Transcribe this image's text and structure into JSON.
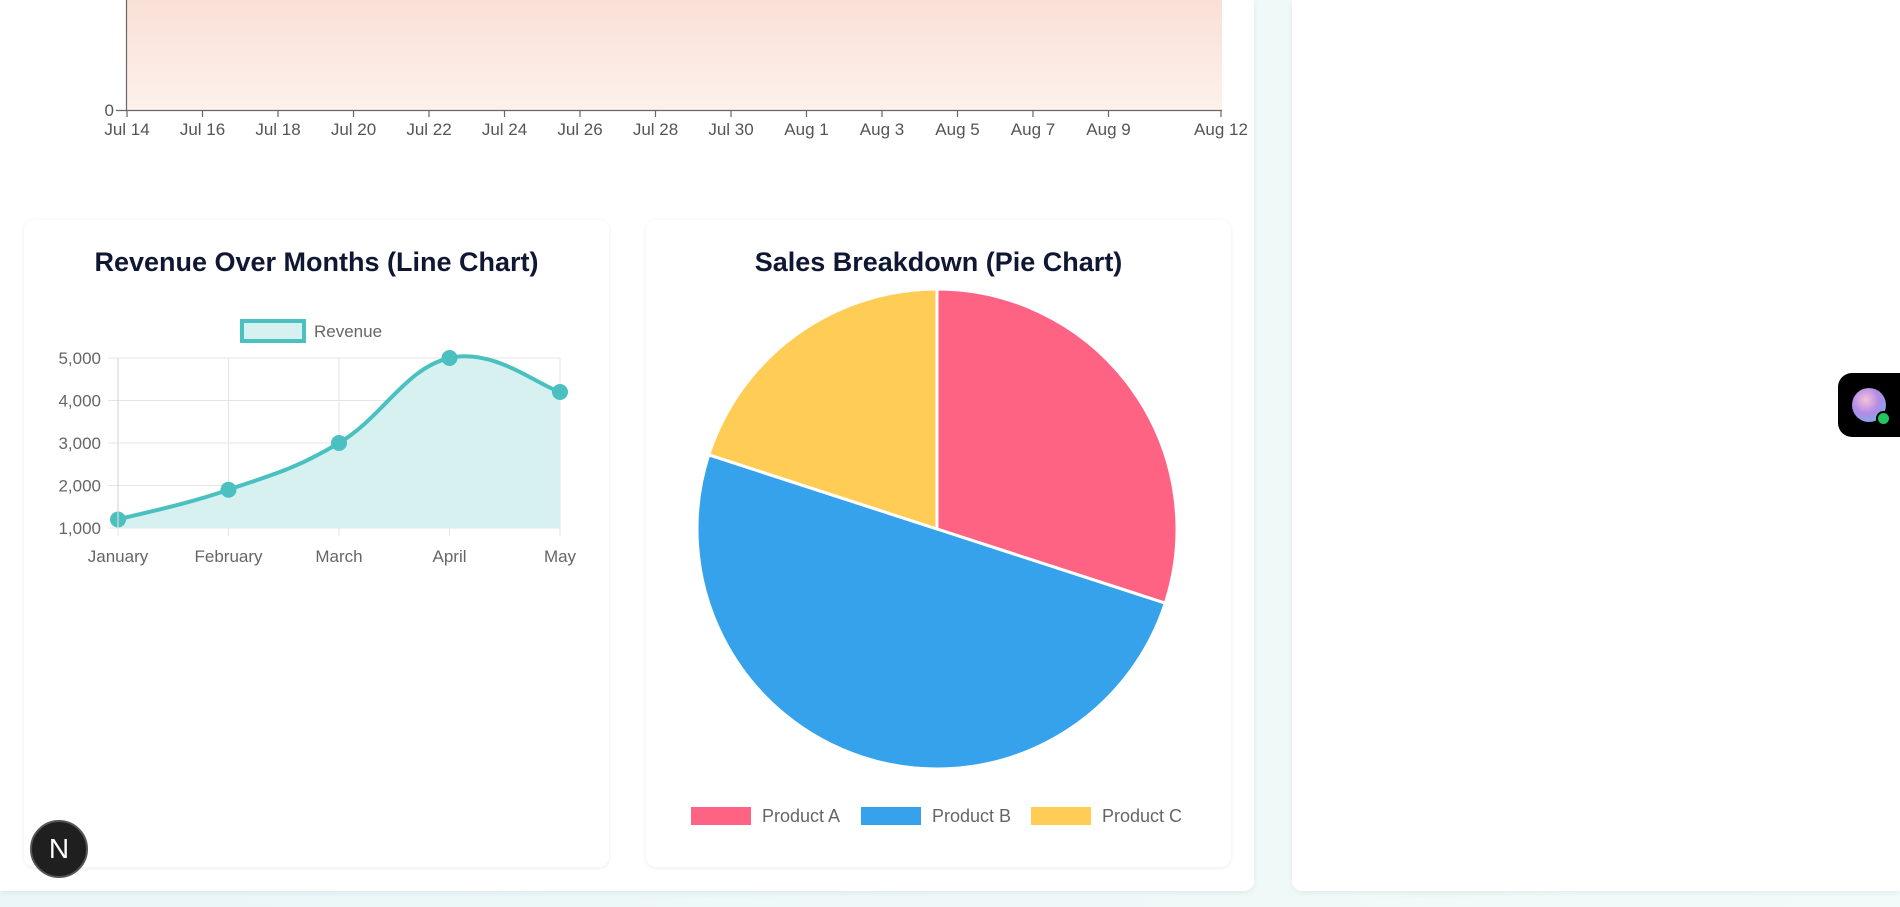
{
  "top_chart": {
    "y_tick": "0",
    "x_ticks": [
      "Jul 14",
      "Jul 16",
      "Jul 18",
      "Jul 20",
      "Jul 22",
      "Jul 24",
      "Jul 26",
      "Jul 28",
      "Jul 30",
      "Aug 1",
      "Aug 3",
      "Aug 5",
      "Aug 7",
      "Aug 9",
      "Aug 12"
    ]
  },
  "line_card": {
    "title": "Revenue Over Months (Line Chart)",
    "legend_label": "Revenue",
    "y_ticks": [
      "5,000",
      "4,000",
      "3,000",
      "2,000",
      "1,000"
    ]
  },
  "pie_card": {
    "title": "Sales Breakdown (Pie Chart)"
  },
  "next_badge": {
    "label": "N"
  },
  "chart_data": [
    {
      "type": "line",
      "title": "Revenue Over Months (Line Chart)",
      "categories": [
        "January",
        "February",
        "March",
        "April",
        "May"
      ],
      "series": [
        {
          "name": "Revenue",
          "values": [
            1200,
            1900,
            3000,
            5000,
            4200
          ]
        }
      ],
      "ylim": [
        1000,
        5000
      ],
      "grid": true,
      "legend": "top",
      "fill": true,
      "colors": {
        "line": "#4bc0c0",
        "fill": "#d7f1f1",
        "grid": "#e5e5e5"
      }
    },
    {
      "type": "pie",
      "title": "Sales Breakdown (Pie Chart)",
      "categories": [
        "Product A",
        "Product B",
        "Product C"
      ],
      "values": [
        30,
        50,
        20
      ],
      "legend": "bottom",
      "colors": [
        "#ff6384",
        "#36a2eb",
        "#ffcd56"
      ]
    }
  ]
}
